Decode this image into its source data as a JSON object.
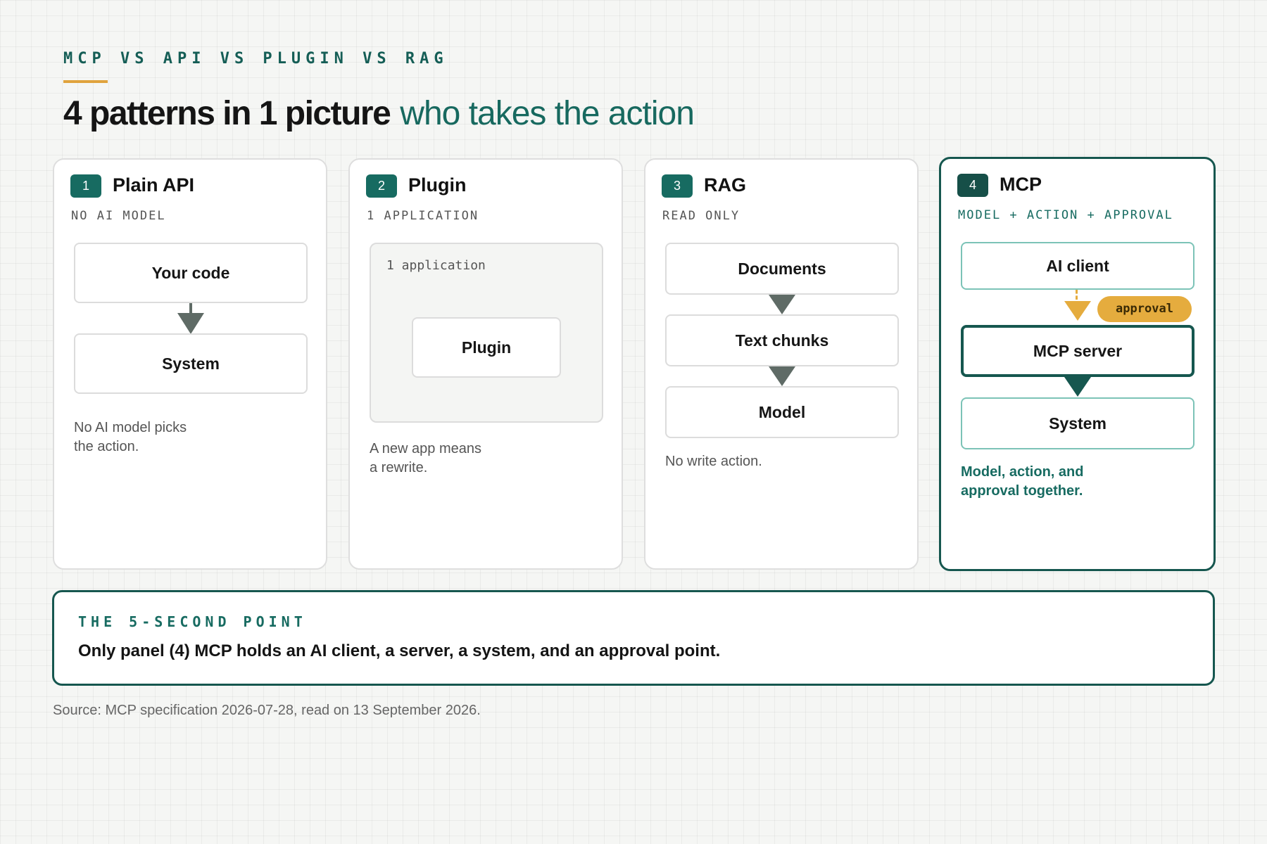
{
  "header": {
    "kicker": "MCP VS API VS PLUGIN VS RAG",
    "title": "4 patterns in 1 picture",
    "title_accent": "who takes the action"
  },
  "panels": [
    {
      "number": "1",
      "name": "Plain API",
      "subtitle": "NO AI MODEL",
      "boxes": [
        "Your code",
        "System"
      ],
      "note_lines": [
        "No AI model picks",
        "the action."
      ]
    },
    {
      "number": "2",
      "name": "Plugin",
      "subtitle": "1 APPLICATION",
      "container_label": "1 application",
      "boxes": [
        "Plugin"
      ],
      "note_lines": [
        "A new app means",
        "a rewrite."
      ]
    },
    {
      "number": "3",
      "name": "RAG",
      "subtitle": "READ ONLY",
      "boxes": [
        "Documents",
        "Text chunks",
        "Model"
      ],
      "note_lines": [
        "No write action."
      ]
    },
    {
      "number": "4",
      "name": "MCP",
      "subtitle": "MODEL + ACTION + APPROVAL",
      "boxes": [
        "AI client",
        "MCP server",
        "System"
      ],
      "badge": "approval",
      "note_lines": [
        "Model, action, and",
        "approval together."
      ]
    }
  ],
  "key_point": {
    "label": "THE 5-SECOND POINT",
    "text": "Only panel (4) MCP holds an AI client, a server, a system, and an approval point."
  },
  "source": "Source: MCP specification 2026-07-28, read on 13 September 2026.",
  "colors": {
    "accent_teal": "#176b61",
    "dark_teal": "#16574f",
    "approval_amber": "#e5ac3e",
    "kicker_underline": "#e0a33d"
  }
}
